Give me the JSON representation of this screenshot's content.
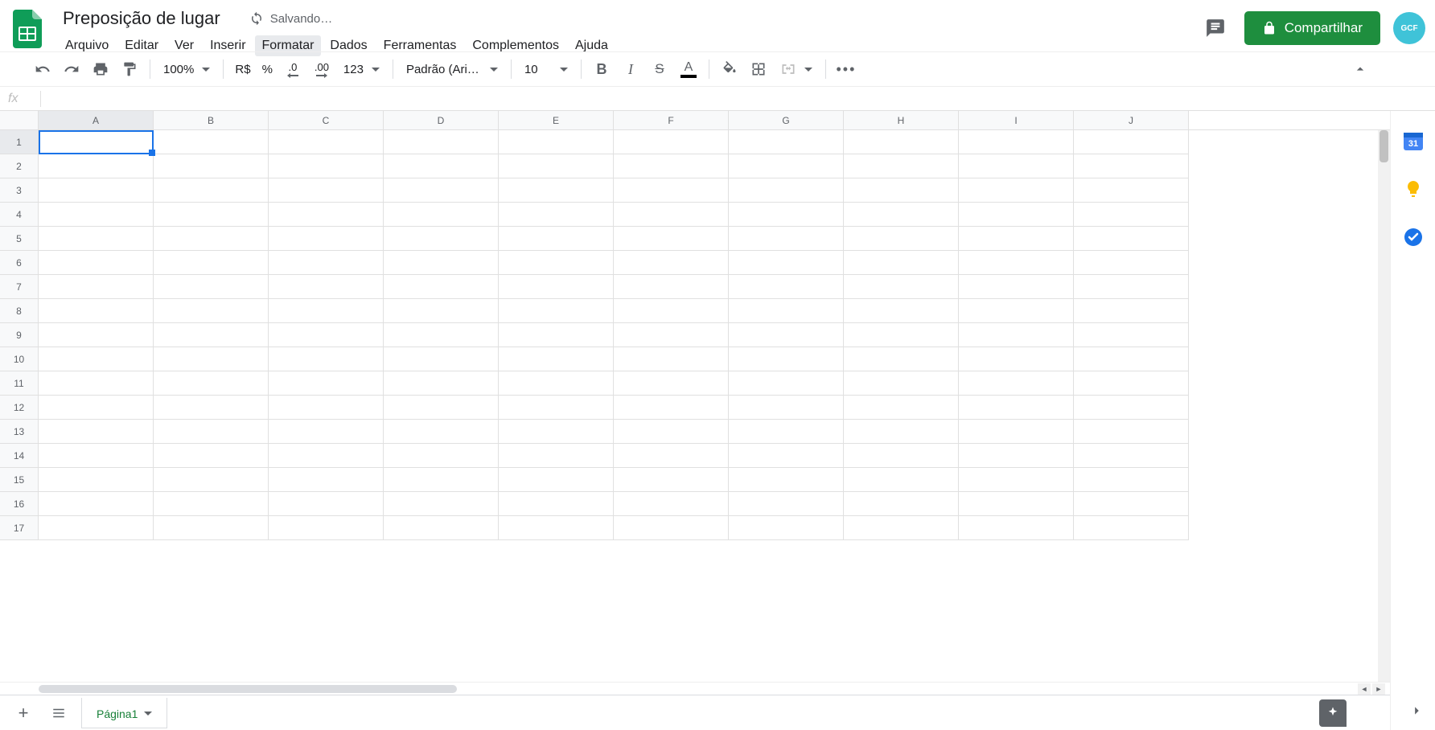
{
  "header": {
    "doc_title": "Preposição de lugar",
    "saving_text": "Salvando…",
    "share_label": "Compartilhar",
    "avatar_text": "GCF"
  },
  "menus": [
    "Arquivo",
    "Editar",
    "Ver",
    "Inserir",
    "Formatar",
    "Dados",
    "Ferramentas",
    "Complementos",
    "Ajuda"
  ],
  "active_menu_index": 4,
  "toolbar": {
    "zoom": "100%",
    "currency": "R$",
    "percent": "%",
    "dec_less": ".0",
    "dec_more": ".00",
    "format_123": "123",
    "font": "Padrão (Ari…",
    "font_size": "10",
    "more": "…"
  },
  "formula": {
    "fx": "fx",
    "value": ""
  },
  "columns": [
    "A",
    "B",
    "C",
    "D",
    "E",
    "F",
    "G",
    "H",
    "I",
    "J"
  ],
  "selected_column_index": 0,
  "row_count": 17,
  "selected_row": 1,
  "bottom": {
    "sheet_name": "Página1"
  },
  "side_panel": {
    "calendar": "31"
  }
}
